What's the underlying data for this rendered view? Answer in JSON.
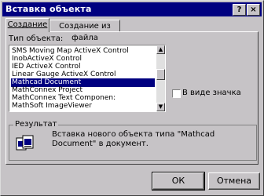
{
  "window": {
    "title": "Вставка объекта",
    "help_label": "?",
    "close_label": "×"
  },
  "tabs": [
    {
      "label": "Создание",
      "active": true
    },
    {
      "label": "Создание из файла",
      "active": false
    }
  ],
  "object_type_label": "Тип объекта:",
  "object_list": [
    "SMS Moving Map ActiveX Control",
    "InobActiveX Control",
    "IED ActiveX Control",
    "Linear Gauge ActiveX Control",
    "Mathcad Document",
    "MathConnex Project",
    "MathConnex Text Componen:",
    "MathSoft ImageViewer"
  ],
  "selected_index": 4,
  "as_icon_label": "В виде значка",
  "result": {
    "title": "Результат",
    "text": "Вставка нового объекта типа \"Mathcad Document\" в документ."
  },
  "buttons": {
    "ok": "ОК",
    "cancel": "Отмена"
  },
  "colors": {
    "titlebar": "#000080",
    "dialog_face": "#c6c3c6",
    "selection": "#000080"
  }
}
